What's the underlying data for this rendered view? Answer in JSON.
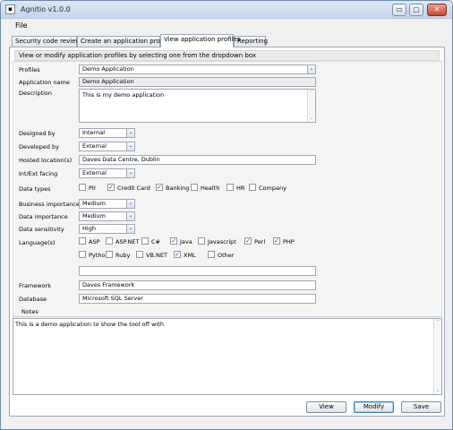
{
  "window": {
    "title": "Agnitio v1.0.0",
    "icon": "app-icon",
    "minimize": "▭",
    "maximize": "▢",
    "close": "✕"
  },
  "menu": {
    "file": "File"
  },
  "tabs": [
    {
      "label": "Security code review"
    },
    {
      "label": "Create an application profile"
    },
    {
      "label": "View application profiles"
    },
    {
      "label": "Reporting"
    }
  ],
  "info": "View or modify application profiles by selecting one from the dropdown box",
  "form": {
    "profiles_label": "Profiles",
    "profiles_value": "Demo Application",
    "appname_label": "Application name",
    "appname_value": "Demo Application",
    "description_label": "Description",
    "description_value": "This is my demo application",
    "designed_label": "Designed by",
    "designed_value": "Internal",
    "developed_label": "Developed by",
    "developed_value": "External",
    "hosted_label": "Hosted location(s)",
    "hosted_value": "Daves Data Centre, Dublin",
    "facing_label": "Int/Ext facing",
    "facing_value": "External",
    "datatypes_label": "Data types",
    "datatypes": [
      {
        "label": "PII",
        "checked": false
      },
      {
        "label": "Credit Card",
        "checked": true
      },
      {
        "label": "Banking",
        "checked": true
      },
      {
        "label": "Health",
        "checked": false
      },
      {
        "label": "HR",
        "checked": false
      },
      {
        "label": "Company",
        "checked": false
      }
    ],
    "business_label": "Business importance",
    "business_value": "Medium",
    "dataimp_label": "Data importance",
    "dataimp_value": "Medium",
    "sensitivity_label": "Data sensitivity",
    "sensitivity_value": "High",
    "languages_label": "Language(s)",
    "languages_row1": [
      {
        "label": "ASP",
        "checked": false
      },
      {
        "label": "ASP.NET",
        "checked": false
      },
      {
        "label": "C#",
        "checked": false
      },
      {
        "label": "Java",
        "checked": true
      },
      {
        "label": "Javascript",
        "checked": false
      },
      {
        "label": "Perl",
        "checked": true
      },
      {
        "label": "PHP",
        "checked": true
      }
    ],
    "languages_row2": [
      {
        "label": "Python",
        "checked": false
      },
      {
        "label": "Ruby",
        "checked": false
      },
      {
        "label": "VB.NET",
        "checked": false
      },
      {
        "label": "XML",
        "checked": true
      },
      {
        "label": "Other",
        "checked": false
      }
    ],
    "other_value": "",
    "framework_label": "Framework",
    "framework_value": "Daves Framework",
    "database_label": "Database",
    "database_value": "Microsoft SQL Server"
  },
  "notes": {
    "label": "Notes",
    "value": "This is a demo application to show the tool off with"
  },
  "buttons": {
    "view": "View",
    "modify": "Modify",
    "save": "Save"
  },
  "glyphs": {
    "dropdown": "⌄",
    "check": "✓",
    "up": "⌃",
    "down": "⌄"
  }
}
